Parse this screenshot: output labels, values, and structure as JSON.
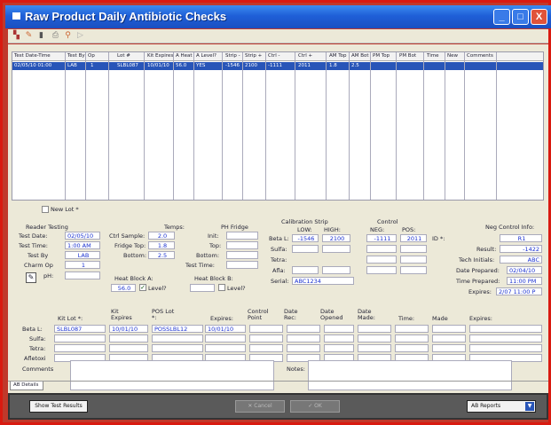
{
  "window": {
    "title": "Raw Product Daily Antibiotic Checks",
    "min": "_",
    "max": "□",
    "close": "X"
  },
  "grid": {
    "headers": [
      "Test Date-Time",
      "Test By",
      "Op",
      "Lot #",
      "Kit Expires",
      "A Heat",
      "A Level?",
      "Strip -",
      "Strip +",
      "Ctrl -",
      "Ctrl +",
      "AM Top",
      "AM Bot",
      "PM Top",
      "PM Bot",
      "Time",
      "New",
      "Comments"
    ],
    "row": [
      "02/05/10 01:00",
      "LAB",
      "1",
      "SLBL087",
      "10/01/10",
      "56.0",
      "YES",
      "-1546",
      "2100",
      "-1111",
      "2011",
      "1.8",
      "2.5"
    ]
  },
  "form": {
    "new_lot": "New Lot *",
    "reader_testing": "Reader Testing",
    "test_date_lbl": "Test Date:",
    "test_date": "02/05/10",
    "test_time_lbl": "Test Time:",
    "test_time": "1:00 AM",
    "test_by_lbl": "Test By",
    "test_by": "LAB",
    "charm_op_lbl": "Charm Op",
    "charm_op": "1",
    "ph_lbl": "pH:",
    "temps": "Temps:",
    "ctrl_sample_lbl": "Ctrl Sample:",
    "ctrl_sample": "2.0",
    "fridge_top_lbl": "Fridge Top:",
    "fridge_top": "1.8",
    "bottom_lbl": "Bottom:",
    "bottom": "2.5",
    "ph_fridge": "PH Fridge",
    "init_lbl": "Init:",
    "top_lbl": "Top:",
    "bottom2_lbl": "Bottom:",
    "test_time2_lbl": "Test Time:",
    "heat_a": "Heat Block A:",
    "heat_a_val": "56.0",
    "level_a": "Level?",
    "heat_b": "Heat Block B:",
    "level_b": "Level?",
    "calib": "Calibration Strip",
    "low": "LOW:",
    "high": "HIGH:",
    "control": "Control",
    "neg": "NEG:",
    "pos": "POS:",
    "beta_l": "Beta L:",
    "low_val": "-1546",
    "high_val": "2100",
    "neg_val": "-1111",
    "pos_val": "2011",
    "sulfa": "Sulfa:",
    "tetra": "Tetra:",
    "afla": "Afla:",
    "serial_lbl": "Serial:",
    "serial": "ABC1234",
    "id_lbl": "ID *:",
    "neg_ctrl_info": "Neg Control Info:",
    "r1": "R1",
    "result_lbl": "Result:",
    "result": "-1422",
    "tech_lbl": "Tech Initials:",
    "tech": "ABC",
    "date_prep_lbl": "Date Prepared:",
    "date_prep": "02/04/10",
    "time_prep_lbl": "Time Prepared:",
    "time_prep": "11:00 PM",
    "expires_lbl": "Expires:",
    "expires": "2/07 11:00 P"
  },
  "lot_table": {
    "headers": [
      "Kit Lot *:",
      "Kit Expires",
      "POS Lot *:",
      "Expires:",
      "Control Point",
      "Date Rec:",
      "Date Opened",
      "Date Made:",
      "Time:",
      "Made",
      "Expires:"
    ],
    "rows": [
      "Beta L:",
      "Sulfa:",
      "Tetra:",
      "Afletoxi"
    ],
    "beta": [
      "SLBL087",
      "10/01/10",
      "POSSLBL12",
      "10/01/10"
    ]
  },
  "comments_lbl": "Comments",
  "notes_lbl": "Notes:",
  "tab": "AB Details",
  "footer": {
    "show": "Show Test Results",
    "cancel": "Cancel",
    "ok": "OK",
    "reports": "AB Reports"
  }
}
